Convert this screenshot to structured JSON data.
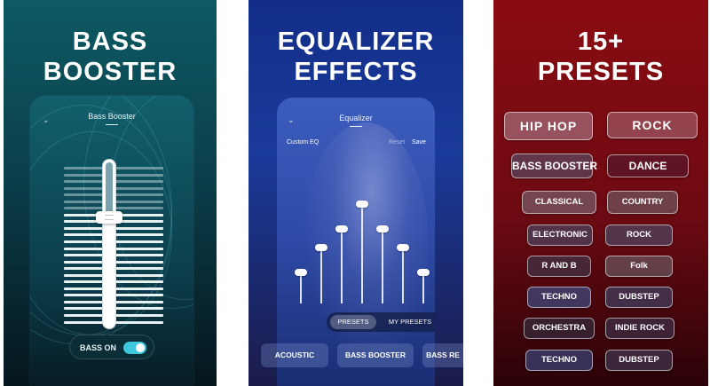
{
  "panel_bass": {
    "headline_line1": "BASS",
    "headline_line2": "BOOSTER",
    "screen_title": "Bass Booster",
    "toggle_label": "BASS ON",
    "toggle_on": true,
    "slider_level": 0.72
  },
  "panel_eq": {
    "headline_line1": "EQUALIZER",
    "headline_line2": "EFFECTS",
    "screen_title": "Equalizer",
    "custom_label": "Custom EQ",
    "reset_label": "Reset",
    "save_label": "Save",
    "tabs": [
      "PRESETS",
      "MY PRESETS"
    ],
    "active_tab": "PRESETS",
    "preset_pills": [
      "ACOUSTIC",
      "BASS BOOSTER",
      "BASS RE"
    ],
    "band_levels": [
      0.25,
      0.45,
      0.6,
      0.8,
      0.6,
      0.45,
      0.25
    ]
  },
  "panel_presets": {
    "headline_line1": "15+",
    "headline_line2": "PRESETS",
    "left_column": [
      "HIP HOP",
      "BASS BOOSTER",
      "CLASSICAL",
      "ELECTRONIC",
      "R AND B",
      "TECHNO",
      "ORCHESTRA",
      "TECHNO"
    ],
    "right_column": [
      "ROCK",
      "DANCE",
      "COUNTRY",
      "ROCK",
      "Folk",
      "DUBSTEP",
      "INDIE ROCK",
      "DUBSTEP"
    ]
  },
  "icons": {
    "back": "chevron-down-icon"
  }
}
